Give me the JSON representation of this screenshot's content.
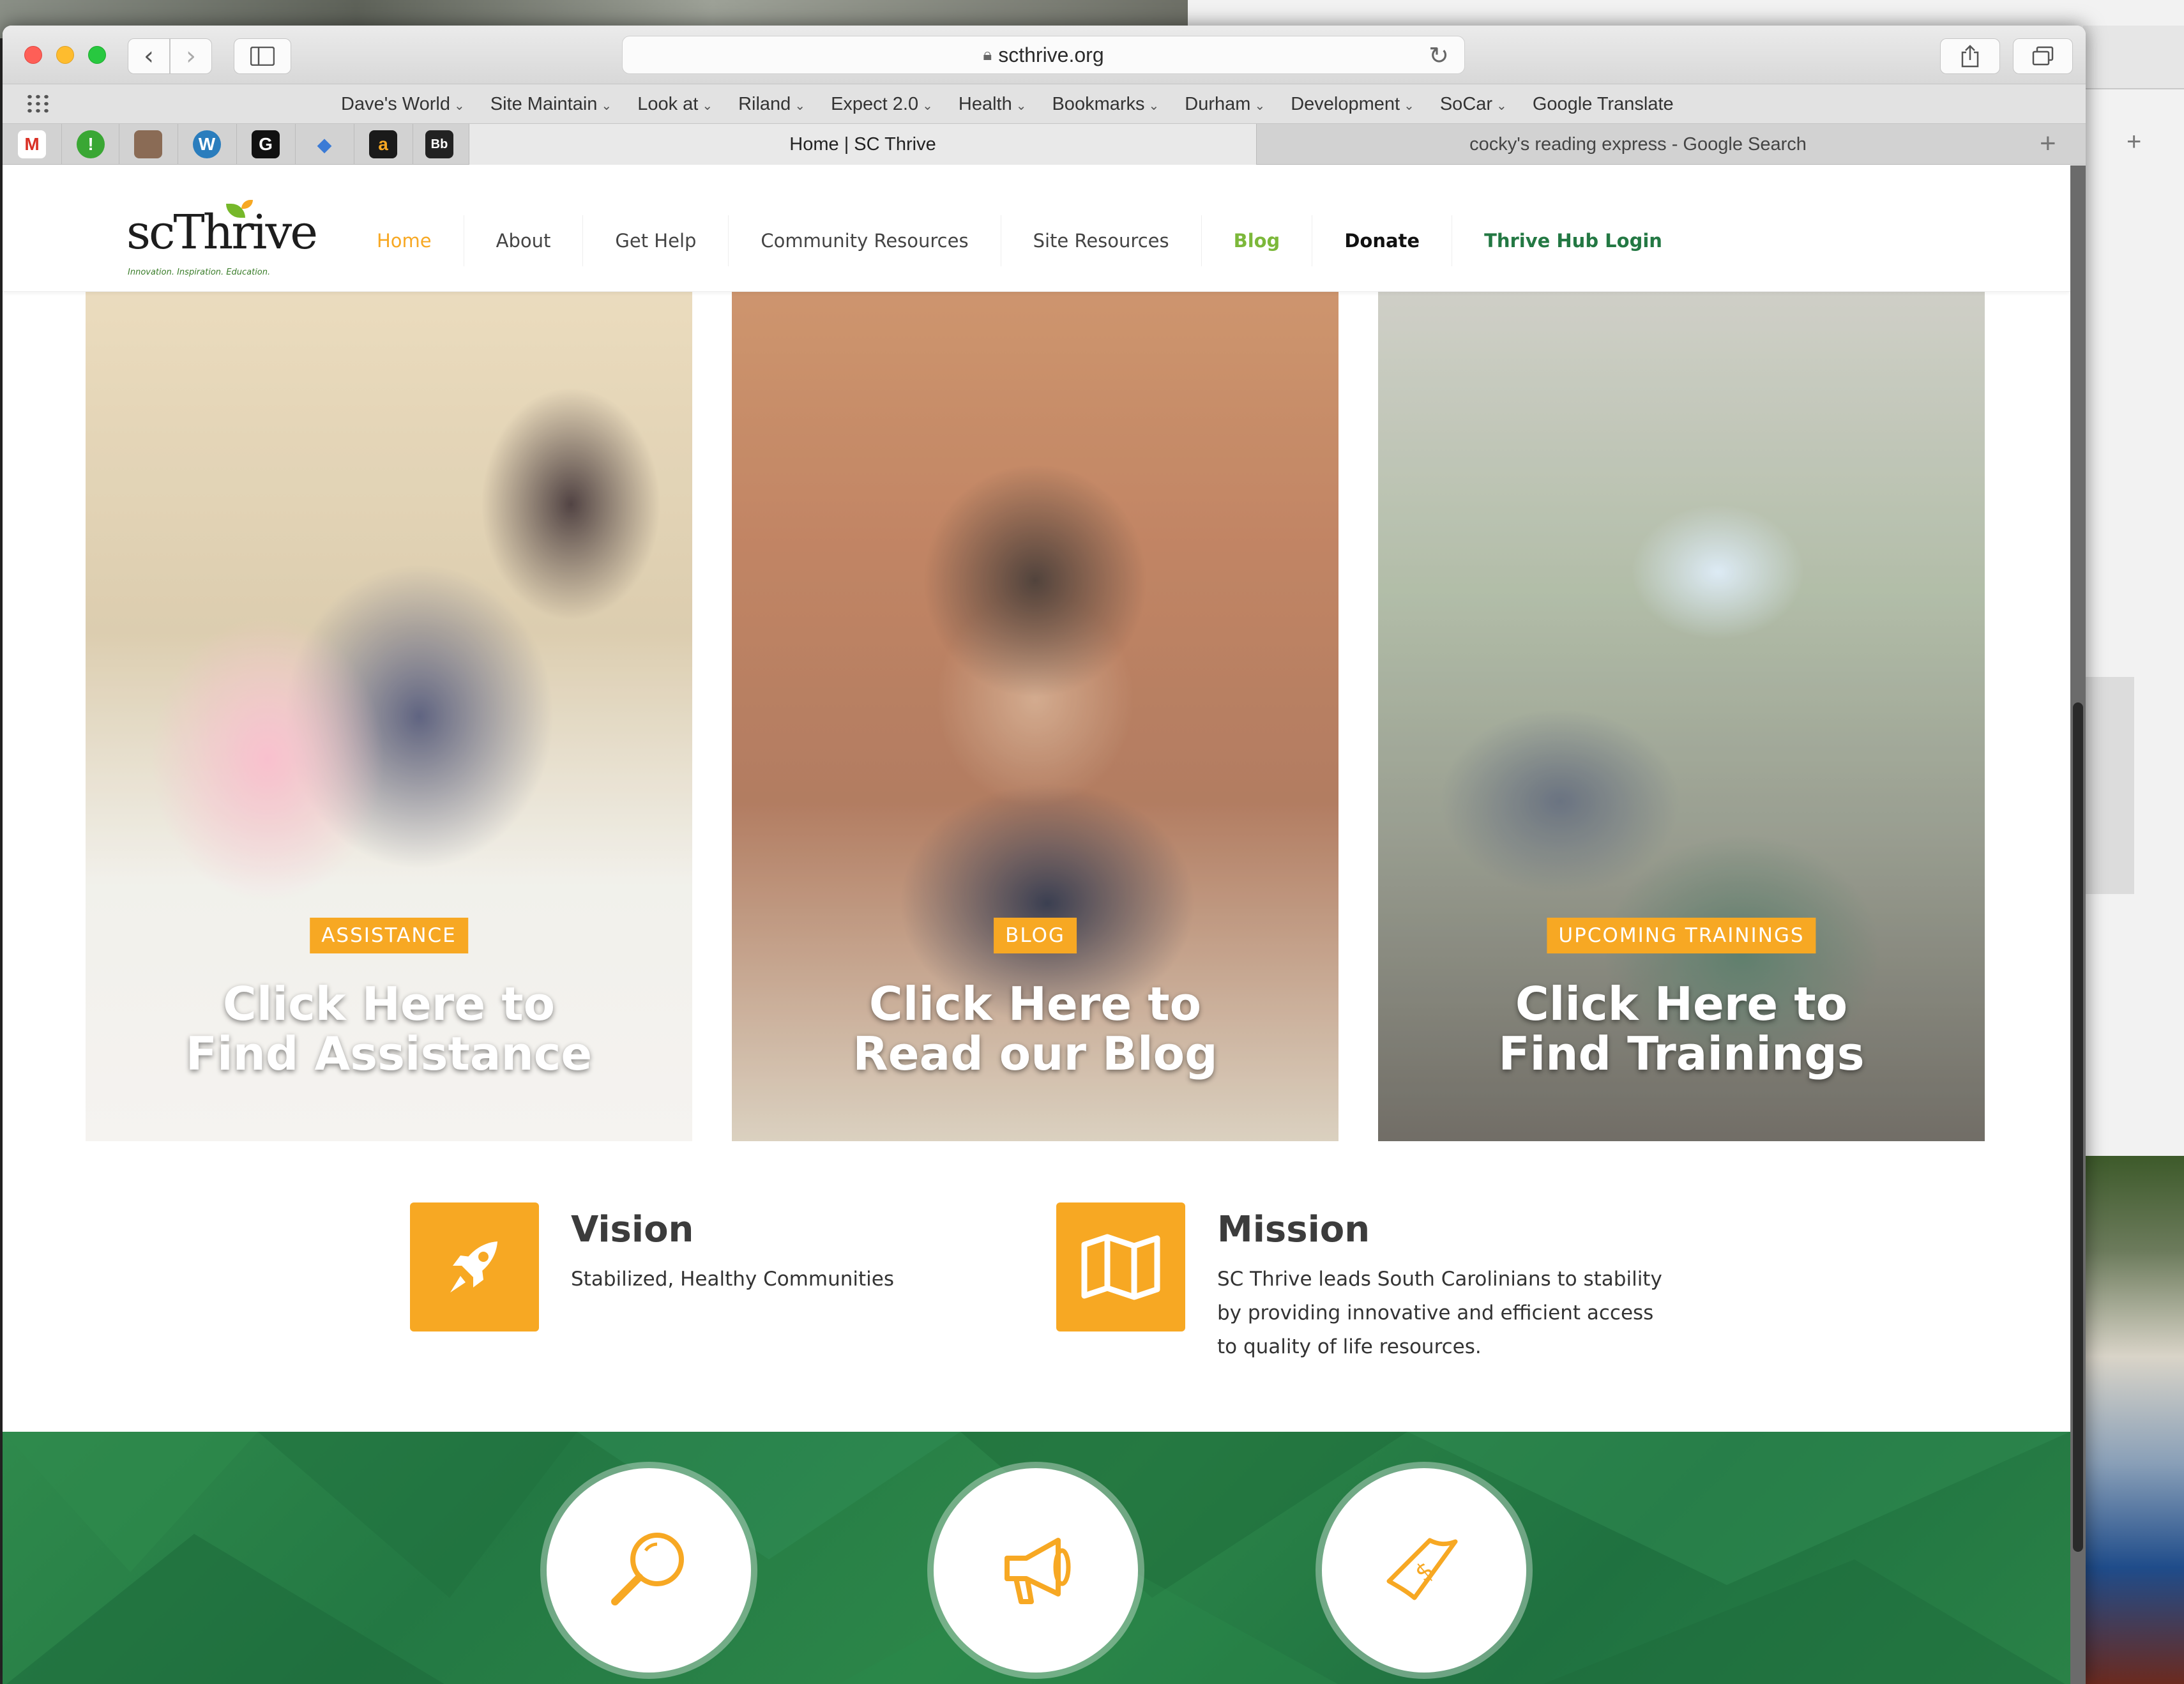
{
  "browser": {
    "url": "scthrive.org",
    "favorites": [
      "Dave's World",
      "Site Maintain",
      "Look at",
      "Riland",
      "Expect 2.0",
      "Health",
      "Bookmarks",
      "Durham",
      "Development",
      "SoCar",
      "Google Translate"
    ],
    "pinned_tabs": [
      {
        "name": "gmail",
        "glyph": "M",
        "color": "#d93025"
      },
      {
        "name": "green-alert",
        "glyph": "!",
        "color": "#3aa734"
      },
      {
        "name": "portrait",
        "glyph": "",
        "color": "#8a6b55"
      },
      {
        "name": "wordpress",
        "glyph": "W",
        "color": "#2a7dbd"
      },
      {
        "name": "g-site",
        "glyph": "G",
        "color": "#111111"
      },
      {
        "name": "dropbox",
        "glyph": "◆",
        "color": "#3b7bd6"
      },
      {
        "name": "amazon",
        "glyph": "a",
        "color": "#1a1a1a"
      },
      {
        "name": "bb",
        "glyph": "Bb",
        "color": "#222222"
      }
    ],
    "active_tab": "Home | SC Thrive",
    "inactive_tab": "cocky's reading express - Google Search"
  },
  "site": {
    "logo": {
      "text": "scThrive",
      "tagline": "Innovation. Inspiration. Education."
    },
    "nav": [
      {
        "label": "Home",
        "color": "#f7a823",
        "weight": "normal"
      },
      {
        "label": "About",
        "color": "#444444",
        "weight": "normal"
      },
      {
        "label": "Get Help",
        "color": "#444444",
        "weight": "normal"
      },
      {
        "label": "Community Resources",
        "color": "#444444",
        "weight": "normal"
      },
      {
        "label": "Site Resources",
        "color": "#444444",
        "weight": "normal"
      },
      {
        "label": "Blog",
        "color": "#7cb83a",
        "weight": "bold"
      },
      {
        "label": "Donate",
        "color": "#111111",
        "weight": "bold"
      },
      {
        "label": "Thrive Hub Login",
        "color": "#237843",
        "weight": "bold"
      }
    ],
    "tiles": [
      {
        "badge": "ASSISTANCE",
        "cta_line1": "Click Here to",
        "cta_line2": "Find Assistance"
      },
      {
        "badge": "BLOG",
        "cta_line1": "Click Here to",
        "cta_line2": "Read our Blog"
      },
      {
        "badge": "UPCOMING TRAININGS",
        "cta_line1": "Click Here to",
        "cta_line2": "Find Trainings"
      }
    ],
    "vision": {
      "title": "Vision",
      "text": "Stabilized, Healthy Communities"
    },
    "mission": {
      "title": "Mission",
      "text": "SC Thrive leads South Carolinians to stability by providing innovative and efficient access to quality of life resources."
    },
    "accent": "#f7a823",
    "band_icons": [
      "search-icon",
      "megaphone-icon",
      "money-icon"
    ]
  }
}
